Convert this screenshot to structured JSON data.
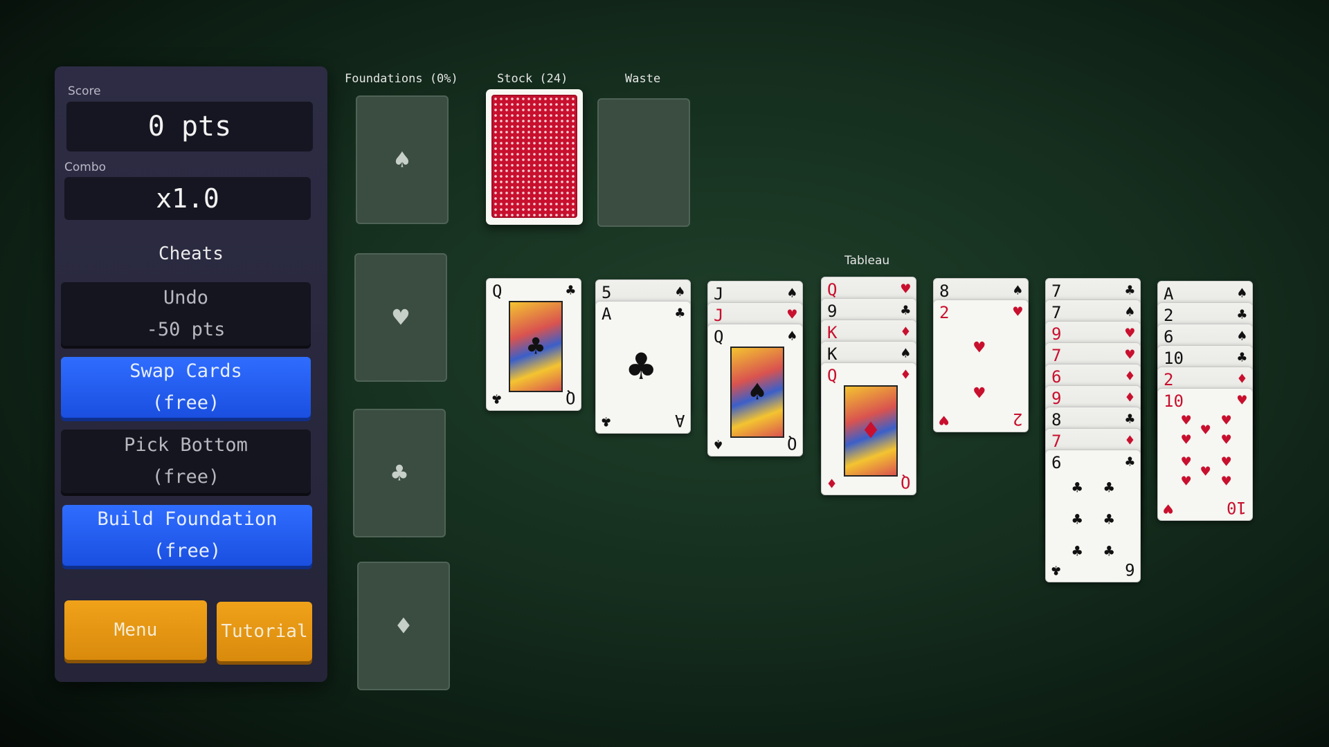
{
  "panel": {
    "score_label": "Score",
    "score_value": "0 pts",
    "combo_label": "Combo",
    "combo_value": "x1.0",
    "cheats_title": "Cheats",
    "undo_label": "Undo",
    "undo_cost": "-50 pts",
    "swap_label": "Swap Cards",
    "swap_cost": "(free)",
    "pick_label": "Pick Bottom",
    "pick_cost": "(free)",
    "build_label": "Build Foundation",
    "build_cost": "(free)",
    "menu_label": "Menu",
    "tutorial_label": "Tutorial"
  },
  "board": {
    "foundations_label": "Foundations (0%)",
    "stock_label": "Stock (24)",
    "waste_label": "Waste",
    "tableau_label": "Tableau",
    "foundation_suits": [
      "♠",
      "♥",
      "♣",
      "♦"
    ]
  },
  "tableau": [
    {
      "stack": [],
      "top": {
        "rank": "Q",
        "suit": "♣",
        "color": "black",
        "type": "face"
      }
    },
    {
      "stack": [
        {
          "rank": "5",
          "suit": "♠",
          "color": "black"
        }
      ],
      "top": {
        "rank": "A",
        "suit": "♣",
        "color": "black",
        "type": "ace"
      }
    },
    {
      "stack": [
        {
          "rank": "J",
          "suit": "♠",
          "color": "black"
        },
        {
          "rank": "J",
          "suit": "♥",
          "color": "red"
        }
      ],
      "top": {
        "rank": "Q",
        "suit": "♠",
        "color": "black",
        "type": "face"
      }
    },
    {
      "stack": [
        {
          "rank": "Q",
          "suit": "♥",
          "color": "red"
        },
        {
          "rank": "9",
          "suit": "♣",
          "color": "black"
        },
        {
          "rank": "K",
          "suit": "♦",
          "color": "red"
        },
        {
          "rank": "K",
          "suit": "♠",
          "color": "black"
        }
      ],
      "top": {
        "rank": "Q",
        "suit": "♦",
        "color": "red",
        "type": "face"
      }
    },
    {
      "stack": [
        {
          "rank": "8",
          "suit": "♠",
          "color": "black"
        }
      ],
      "top": {
        "rank": "2",
        "suit": "♥",
        "color": "red",
        "type": "two"
      }
    },
    {
      "stack": [
        {
          "rank": "7",
          "suit": "♣",
          "color": "black"
        },
        {
          "rank": "7",
          "suit": "♠",
          "color": "black"
        },
        {
          "rank": "9",
          "suit": "♥",
          "color": "red"
        },
        {
          "rank": "7",
          "suit": "♥",
          "color": "red"
        },
        {
          "rank": "6",
          "suit": "♦",
          "color": "red"
        },
        {
          "rank": "9",
          "suit": "♦",
          "color": "red"
        },
        {
          "rank": "8",
          "suit": "♣",
          "color": "black"
        },
        {
          "rank": "7",
          "suit": "♦",
          "color": "red"
        }
      ],
      "top": {
        "rank": "6",
        "suit": "♣",
        "color": "black",
        "type": "six"
      }
    },
    {
      "stack": [
        {
          "rank": "A",
          "suit": "♠",
          "color": "black"
        },
        {
          "rank": "2",
          "suit": "♣",
          "color": "black"
        },
        {
          "rank": "6",
          "suit": "♠",
          "color": "black"
        },
        {
          "rank": "10",
          "suit": "♣",
          "color": "black"
        },
        {
          "rank": "2",
          "suit": "♦",
          "color": "red"
        }
      ],
      "top": {
        "rank": "10",
        "suit": "♥",
        "color": "red",
        "type": "ten"
      }
    }
  ]
}
